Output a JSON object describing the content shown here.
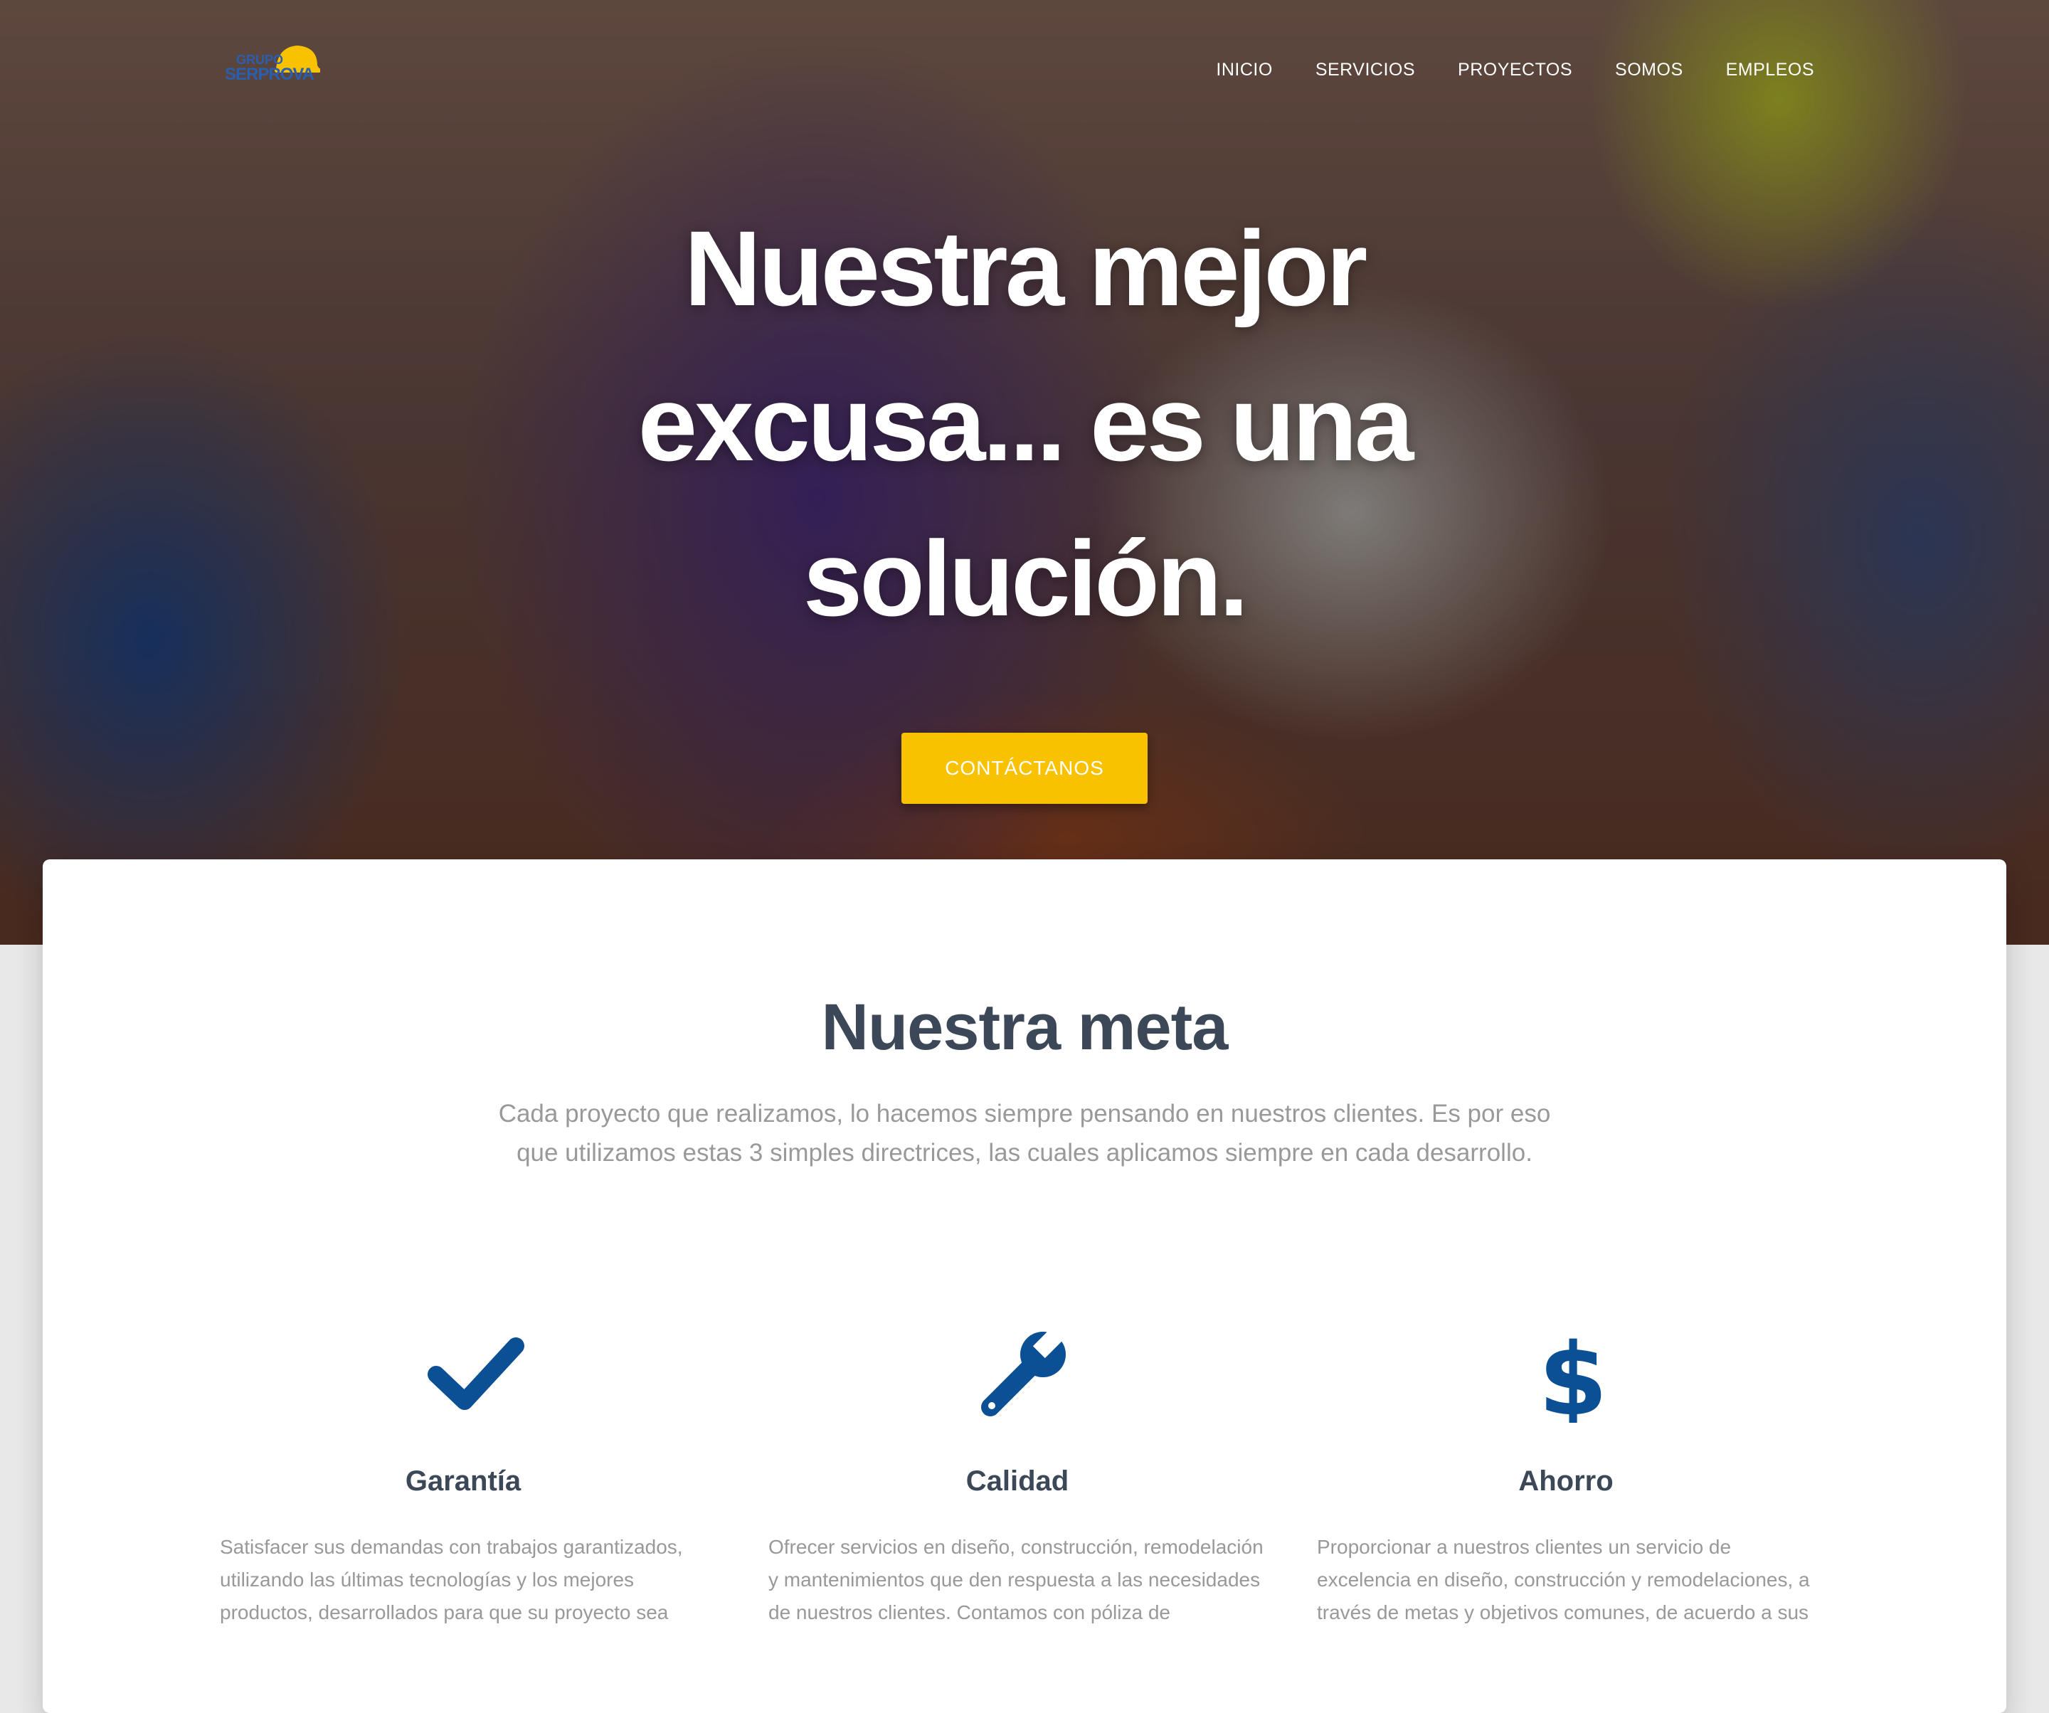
{
  "brand": {
    "logo_line1": "GRUPO",
    "logo_line2": "SERPROVA",
    "colors": {
      "accent": "#f8c200",
      "icon": "#0b4f94",
      "heading": "#3c4858",
      "body_text": "#999999"
    }
  },
  "nav": {
    "items": [
      "INICIO",
      "SERVICIOS",
      "PROYECTOS",
      "SOMOS",
      "EMPLEOS"
    ]
  },
  "hero": {
    "title": "Nuestra mejor excusa... es una solución.",
    "cta_label": "CONTÁCTANOS"
  },
  "goal": {
    "title": "Nuestra meta",
    "description": "Cada proyecto que realizamos, lo hacemos siempre pensando en nuestros clientes. Es por eso que utilizamos estas 3 simples directrices, las cuales aplicamos siempre en cada desarrollo."
  },
  "features": [
    {
      "icon": "checkmark-icon",
      "title": "Garantía",
      "text": "Satisfacer sus demandas con trabajos garantizados, utilizando las últimas tecnologías y los mejores productos, desarrollados para que su proyecto sea"
    },
    {
      "icon": "wrench-icon",
      "title": "Calidad",
      "text": "Ofrecer servicios en diseño, construcción, remodelación y mantenimientos que den respuesta a las necesidades de nuestros clientes. Contamos con póliza de"
    },
    {
      "icon": "dollar-icon",
      "title": "Ahorro",
      "text": "Proporcionar a nuestros clientes un servicio de excelencia en diseño, construcción y remodelaciones, a través de metas y objetivos comunes, de acuerdo a sus"
    }
  ]
}
